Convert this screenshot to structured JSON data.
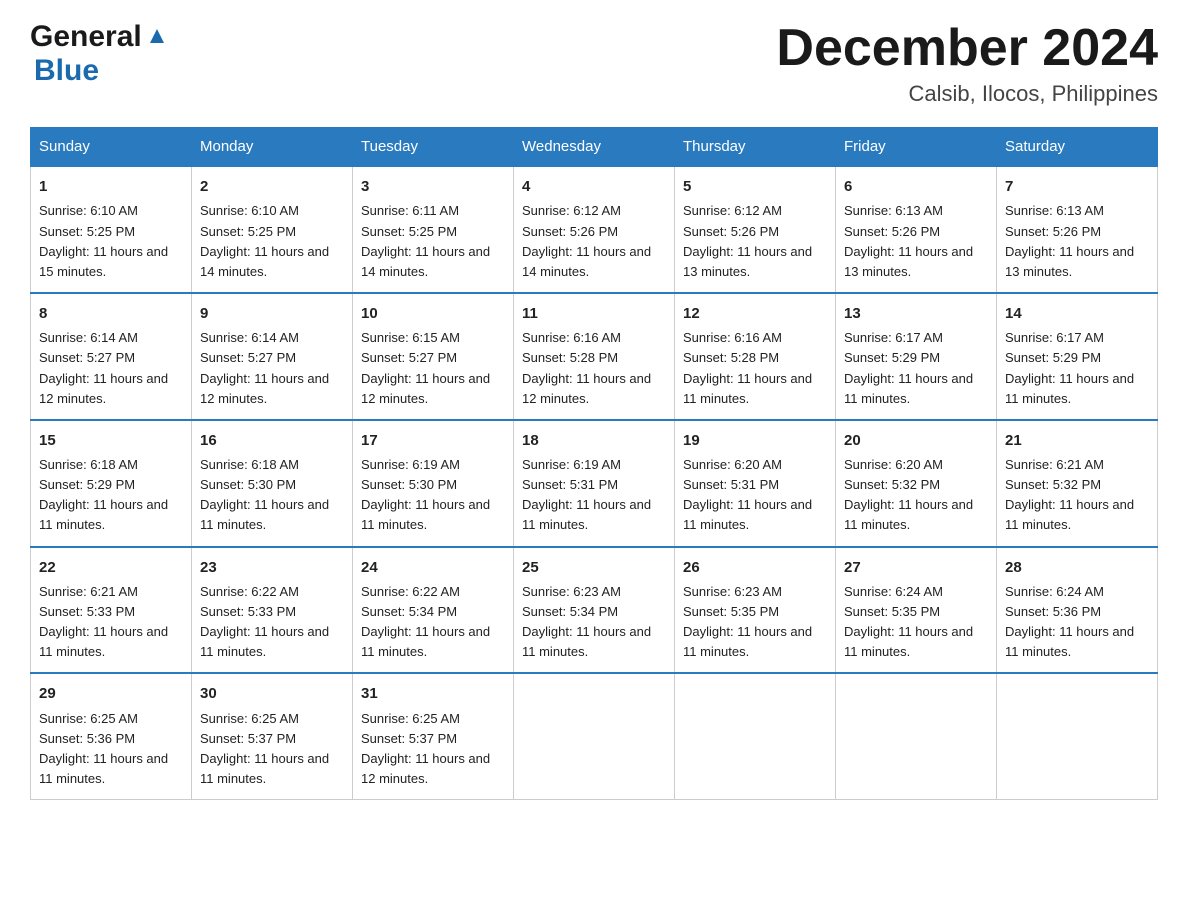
{
  "header": {
    "logo_general": "General",
    "logo_blue": "Blue",
    "month_title": "December 2024",
    "location": "Calsib, Ilocos, Philippines"
  },
  "days_of_week": [
    "Sunday",
    "Monday",
    "Tuesday",
    "Wednesday",
    "Thursday",
    "Friday",
    "Saturday"
  ],
  "weeks": [
    [
      {
        "day": "1",
        "sunrise": "6:10 AM",
        "sunset": "5:25 PM",
        "daylight": "11 hours and 15 minutes."
      },
      {
        "day": "2",
        "sunrise": "6:10 AM",
        "sunset": "5:25 PM",
        "daylight": "11 hours and 14 minutes."
      },
      {
        "day": "3",
        "sunrise": "6:11 AM",
        "sunset": "5:25 PM",
        "daylight": "11 hours and 14 minutes."
      },
      {
        "day": "4",
        "sunrise": "6:12 AM",
        "sunset": "5:26 PM",
        "daylight": "11 hours and 14 minutes."
      },
      {
        "day": "5",
        "sunrise": "6:12 AM",
        "sunset": "5:26 PM",
        "daylight": "11 hours and 13 minutes."
      },
      {
        "day": "6",
        "sunrise": "6:13 AM",
        "sunset": "5:26 PM",
        "daylight": "11 hours and 13 minutes."
      },
      {
        "day": "7",
        "sunrise": "6:13 AM",
        "sunset": "5:26 PM",
        "daylight": "11 hours and 13 minutes."
      }
    ],
    [
      {
        "day": "8",
        "sunrise": "6:14 AM",
        "sunset": "5:27 PM",
        "daylight": "11 hours and 12 minutes."
      },
      {
        "day": "9",
        "sunrise": "6:14 AM",
        "sunset": "5:27 PM",
        "daylight": "11 hours and 12 minutes."
      },
      {
        "day": "10",
        "sunrise": "6:15 AM",
        "sunset": "5:27 PM",
        "daylight": "11 hours and 12 minutes."
      },
      {
        "day": "11",
        "sunrise": "6:16 AM",
        "sunset": "5:28 PM",
        "daylight": "11 hours and 12 minutes."
      },
      {
        "day": "12",
        "sunrise": "6:16 AM",
        "sunset": "5:28 PM",
        "daylight": "11 hours and 11 minutes."
      },
      {
        "day": "13",
        "sunrise": "6:17 AM",
        "sunset": "5:29 PM",
        "daylight": "11 hours and 11 minutes."
      },
      {
        "day": "14",
        "sunrise": "6:17 AM",
        "sunset": "5:29 PM",
        "daylight": "11 hours and 11 minutes."
      }
    ],
    [
      {
        "day": "15",
        "sunrise": "6:18 AM",
        "sunset": "5:29 PM",
        "daylight": "11 hours and 11 minutes."
      },
      {
        "day": "16",
        "sunrise": "6:18 AM",
        "sunset": "5:30 PM",
        "daylight": "11 hours and 11 minutes."
      },
      {
        "day": "17",
        "sunrise": "6:19 AM",
        "sunset": "5:30 PM",
        "daylight": "11 hours and 11 minutes."
      },
      {
        "day": "18",
        "sunrise": "6:19 AM",
        "sunset": "5:31 PM",
        "daylight": "11 hours and 11 minutes."
      },
      {
        "day": "19",
        "sunrise": "6:20 AM",
        "sunset": "5:31 PM",
        "daylight": "11 hours and 11 minutes."
      },
      {
        "day": "20",
        "sunrise": "6:20 AM",
        "sunset": "5:32 PM",
        "daylight": "11 hours and 11 minutes."
      },
      {
        "day": "21",
        "sunrise": "6:21 AM",
        "sunset": "5:32 PM",
        "daylight": "11 hours and 11 minutes."
      }
    ],
    [
      {
        "day": "22",
        "sunrise": "6:21 AM",
        "sunset": "5:33 PM",
        "daylight": "11 hours and 11 minutes."
      },
      {
        "day": "23",
        "sunrise": "6:22 AM",
        "sunset": "5:33 PM",
        "daylight": "11 hours and 11 minutes."
      },
      {
        "day": "24",
        "sunrise": "6:22 AM",
        "sunset": "5:34 PM",
        "daylight": "11 hours and 11 minutes."
      },
      {
        "day": "25",
        "sunrise": "6:23 AM",
        "sunset": "5:34 PM",
        "daylight": "11 hours and 11 minutes."
      },
      {
        "day": "26",
        "sunrise": "6:23 AM",
        "sunset": "5:35 PM",
        "daylight": "11 hours and 11 minutes."
      },
      {
        "day": "27",
        "sunrise": "6:24 AM",
        "sunset": "5:35 PM",
        "daylight": "11 hours and 11 minutes."
      },
      {
        "day": "28",
        "sunrise": "6:24 AM",
        "sunset": "5:36 PM",
        "daylight": "11 hours and 11 minutes."
      }
    ],
    [
      {
        "day": "29",
        "sunrise": "6:25 AM",
        "sunset": "5:36 PM",
        "daylight": "11 hours and 11 minutes."
      },
      {
        "day": "30",
        "sunrise": "6:25 AM",
        "sunset": "5:37 PM",
        "daylight": "11 hours and 11 minutes."
      },
      {
        "day": "31",
        "sunrise": "6:25 AM",
        "sunset": "5:37 PM",
        "daylight": "11 hours and 12 minutes."
      },
      null,
      null,
      null,
      null
    ]
  ],
  "cell_labels": {
    "sunrise_prefix": "Sunrise: ",
    "sunset_prefix": "Sunset: ",
    "daylight_prefix": "Daylight: "
  }
}
